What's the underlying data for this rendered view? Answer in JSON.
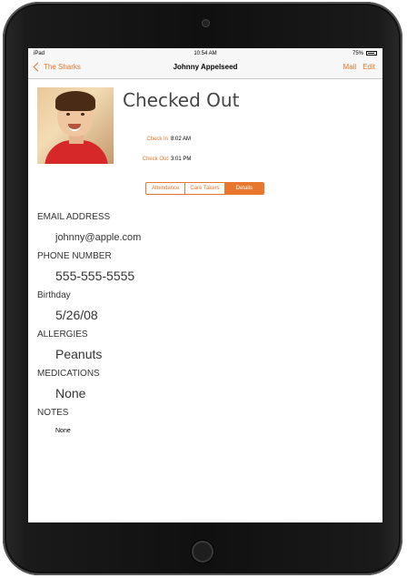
{
  "status_bar": {
    "device": "iPad",
    "time": "10:54 AM",
    "battery": "75%"
  },
  "nav": {
    "back_label": "The Sharks",
    "title": "Johnny Appelseed",
    "mail_label": "Mail",
    "edit_label": "Edit"
  },
  "header": {
    "status": "Checked Out",
    "check_in_label": "Check In",
    "check_in_time": "8:02 AM",
    "check_out_label": "Check Out",
    "check_out_time": "3:01 PM"
  },
  "segments": {
    "items": [
      "Attendance",
      "Care Takers",
      "Details"
    ],
    "selected": "Details"
  },
  "details": {
    "email_label": "EMAIL ADDRESS",
    "email": "johnny@apple.com",
    "phone_label": "PHONE NUMBER",
    "phone": "555-555-5555",
    "birthday_label": "Birthday",
    "birthday": "5/26/08",
    "allergies_label": "ALLERGIES",
    "allergies": "Peanuts",
    "medications_label": "MEDICATIONS",
    "medications": "None",
    "notes_label": "NOTES",
    "notes": "None"
  },
  "colors": {
    "accent": "#e8762d"
  }
}
